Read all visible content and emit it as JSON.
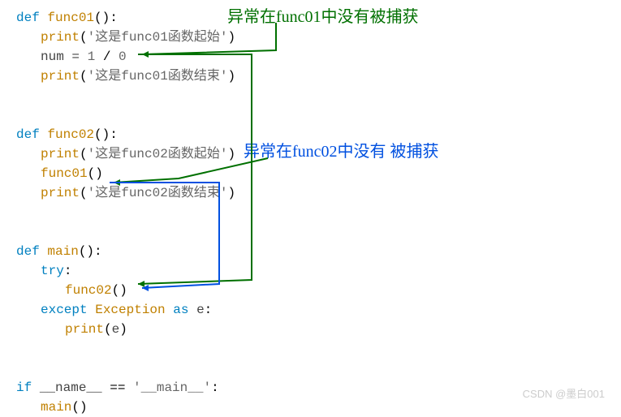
{
  "annotations": {
    "a1": "异常在func01中没有被捕获",
    "a2": "异常在func02中没有  被捕获"
  },
  "code": {
    "def": "def",
    "func01": "func01",
    "func02": "func02",
    "main": "main",
    "try": "try",
    "except": "except",
    "exception": "Exception",
    "as": "as",
    "evar": "e",
    "print": "print",
    "if": "if",
    "dunder_name": "__name__",
    "eq": "==",
    "dunder_main": "'__main__'",
    "s_func01_start": "'这是func01函数起始'",
    "s_func01_end": "'这是func01函数结束'",
    "s_func02_start": "'这是func02函数起始'",
    "s_func02_end": "'这是func02函数结束'",
    "num_assign_lhs": "num = ",
    "num_1": "1",
    "slash": " / ",
    "num_0": "0"
  },
  "watermark": "CSDN @墨白001"
}
